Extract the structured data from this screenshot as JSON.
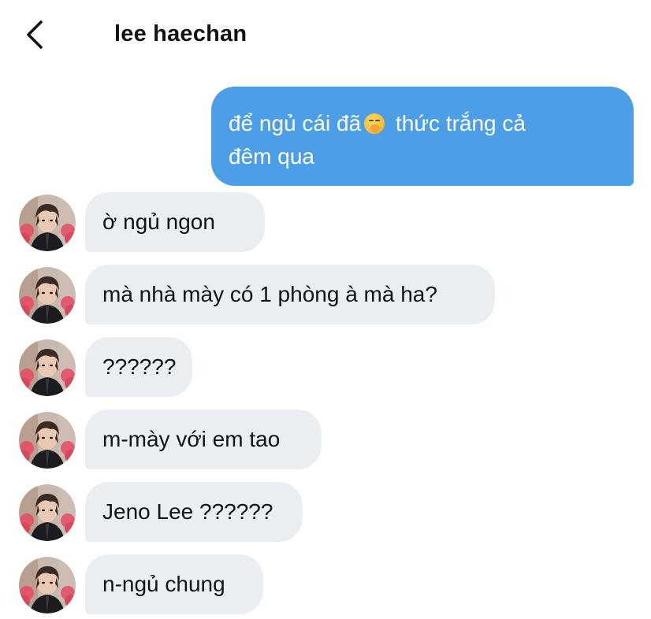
{
  "header": {
    "back_icon": "chevron-left-icon",
    "title": "lee haechan"
  },
  "outgoing": {
    "line1_before_emoji": "để ngủ cái đã",
    "emoji": "yawning-face-emoji",
    "line1_after_emoji": "thức trắng cả",
    "line2": "đêm qua",
    "bubble_color": "#4c9fe6"
  },
  "incoming": [
    {
      "text": "ờ ngủ ngon"
    },
    {
      "text": "mà nhà mày có 1 phòng à mà ha?"
    },
    {
      "text": "??????"
    },
    {
      "text": "m-mày với em tao"
    },
    {
      "text": "Jeno Lee ??????"
    },
    {
      "text": "n-ngủ chung"
    }
  ],
  "colors": {
    "incoming_bubble": "#eaeef2",
    "text": "#0f1419"
  }
}
